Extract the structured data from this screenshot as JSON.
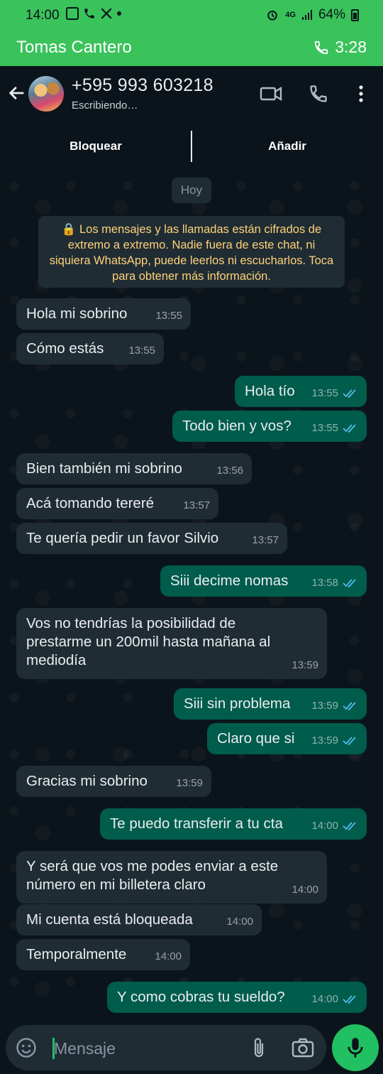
{
  "status_bar": {
    "time": "14:00",
    "network": "4G",
    "battery": "64%"
  },
  "call_banner": {
    "name": "Tomas Cantero",
    "duration": "3:28"
  },
  "chat_header": {
    "contact": "+595 993 603218",
    "status": "Escribiendo…"
  },
  "action_bar": {
    "block_label": "Bloquear",
    "add_label": "Añadir"
  },
  "date_chip": "Hoy",
  "encryption_notice": "🔒 Los mensajes y las llamadas están cifrados de extremo a extremo. Nadie fuera de este chat, ni siquiera WhatsApp, puede leerlos ni escucharlos. Toca para obtener más información.",
  "messages": [
    {
      "dir": "in",
      "text": "Hola mi sobrino",
      "time": "13:55"
    },
    {
      "dir": "in",
      "text": "Cómo estás",
      "time": "13:55"
    },
    {
      "dir": "out",
      "text": "Hola tío",
      "time": "13:55"
    },
    {
      "dir": "out",
      "text": "Todo bien y vos?",
      "time": "13:55"
    },
    {
      "dir": "in",
      "text": "Bien también mi sobrino",
      "time": "13:56"
    },
    {
      "dir": "in",
      "text": "Acá tomando tereré",
      "time": "13:57"
    },
    {
      "dir": "in",
      "text": "Te quería pedir un favor Silvio",
      "time": "13:57"
    },
    {
      "dir": "out",
      "text": "Siii decime nomas",
      "time": "13:58"
    },
    {
      "dir": "in",
      "text": "Vos no tendrías la posibilidad de\nprestarme un 200mil hasta mañana al\nmediodía",
      "time": "13:59"
    },
    {
      "dir": "out",
      "text": "Siii sin problema",
      "time": "13:59"
    },
    {
      "dir": "out",
      "text": "Claro que si",
      "time": "13:59"
    },
    {
      "dir": "in",
      "text": "Gracias mi sobrino",
      "time": "13:59"
    },
    {
      "dir": "out",
      "text": "Te puedo transferir a tu cta",
      "time": "14:00"
    },
    {
      "dir": "in",
      "text": "Y será que vos me podes enviar a este\nnúmero en mi billetera claro",
      "time": "14:00"
    },
    {
      "dir": "in",
      "text": "Mi cuenta está bloqueada",
      "time": "14:00"
    },
    {
      "dir": "in",
      "text": "Temporalmente",
      "time": "14:00"
    },
    {
      "dir": "out",
      "text": "Y como cobras tu sueldo?",
      "time": "14:00"
    }
  ],
  "input": {
    "placeholder": "Mensaje"
  },
  "colors": {
    "banner_green": "#3ac25b",
    "incoming_bubble": "#202c33",
    "outgoing_bubble": "#005c4b",
    "read_ticks": "#53bdeb",
    "notice_text": "#ffd279",
    "mic_button": "#21c063"
  },
  "icons": {
    "status": [
      "gallery-icon",
      "phone-icon",
      "x-logo-icon",
      "alarm-icon",
      "signal-icon",
      "battery-icon"
    ],
    "header": [
      "back-arrow-icon",
      "video-call-icon",
      "voice-call-icon",
      "more-options-icon"
    ],
    "input": [
      "emoji-icon",
      "attach-icon",
      "camera-icon",
      "mic-icon"
    ]
  }
}
